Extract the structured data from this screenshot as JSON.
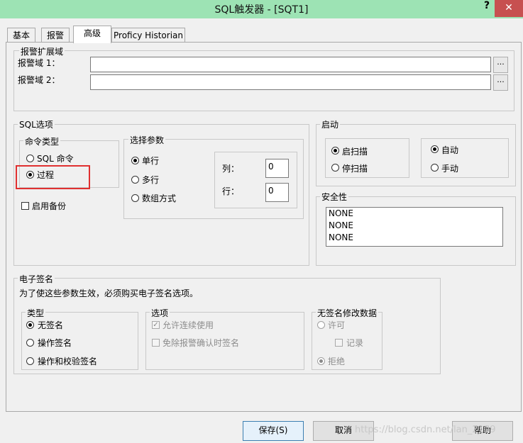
{
  "window": {
    "title": "SQL触发器 - [SQT1]",
    "help": "?",
    "close": "✕"
  },
  "tabs": [
    "基本",
    "报警",
    "高级",
    "Proficy Historian"
  ],
  "alarm_ext": {
    "group": "报警扩展域",
    "field1_label": "报警域 1：",
    "field2_label": "报警域 2：",
    "field1_value": "",
    "field2_value": "",
    "browse": "..."
  },
  "sql_options": {
    "group": "SQL选项",
    "cmd_type": {
      "group": "命令类型",
      "sql_cmd": "SQL 命令",
      "procedure": "过程"
    },
    "enable_backup": "启用备份",
    "select_params": {
      "group": "选择参数",
      "single": "单行",
      "multi": "多行",
      "array": "数组方式",
      "col_label": "列：",
      "col_value": "0",
      "row_label": "行：",
      "row_value": "0"
    }
  },
  "startup": {
    "group": "启动",
    "scan_on": "启扫描",
    "scan_off": "停扫描",
    "auto": "自动",
    "manual": "手动"
  },
  "security": {
    "group": "安全性",
    "items": [
      "NONE",
      "NONE",
      "NONE"
    ]
  },
  "esig": {
    "group": "电子签名",
    "notice": "为了使这些参数生效，必须购买电子签名选项。",
    "type": {
      "group": "类型",
      "none": "无签名",
      "perform": "操作签名",
      "perform_verify": "操作和校验签名"
    },
    "options": {
      "group": "选项",
      "allow_continuous": "允许连续使用",
      "exempt_ack": "免除报警确认时签名"
    },
    "unsigned": {
      "group": "无签名修改数据",
      "allow": "许可",
      "log": "记录",
      "reject": "拒绝"
    }
  },
  "buttons": {
    "save": "保存(S)",
    "cancel": "取消",
    "help": "帮助"
  },
  "watermark": "https://blog.csdn.net/lan_2109"
}
